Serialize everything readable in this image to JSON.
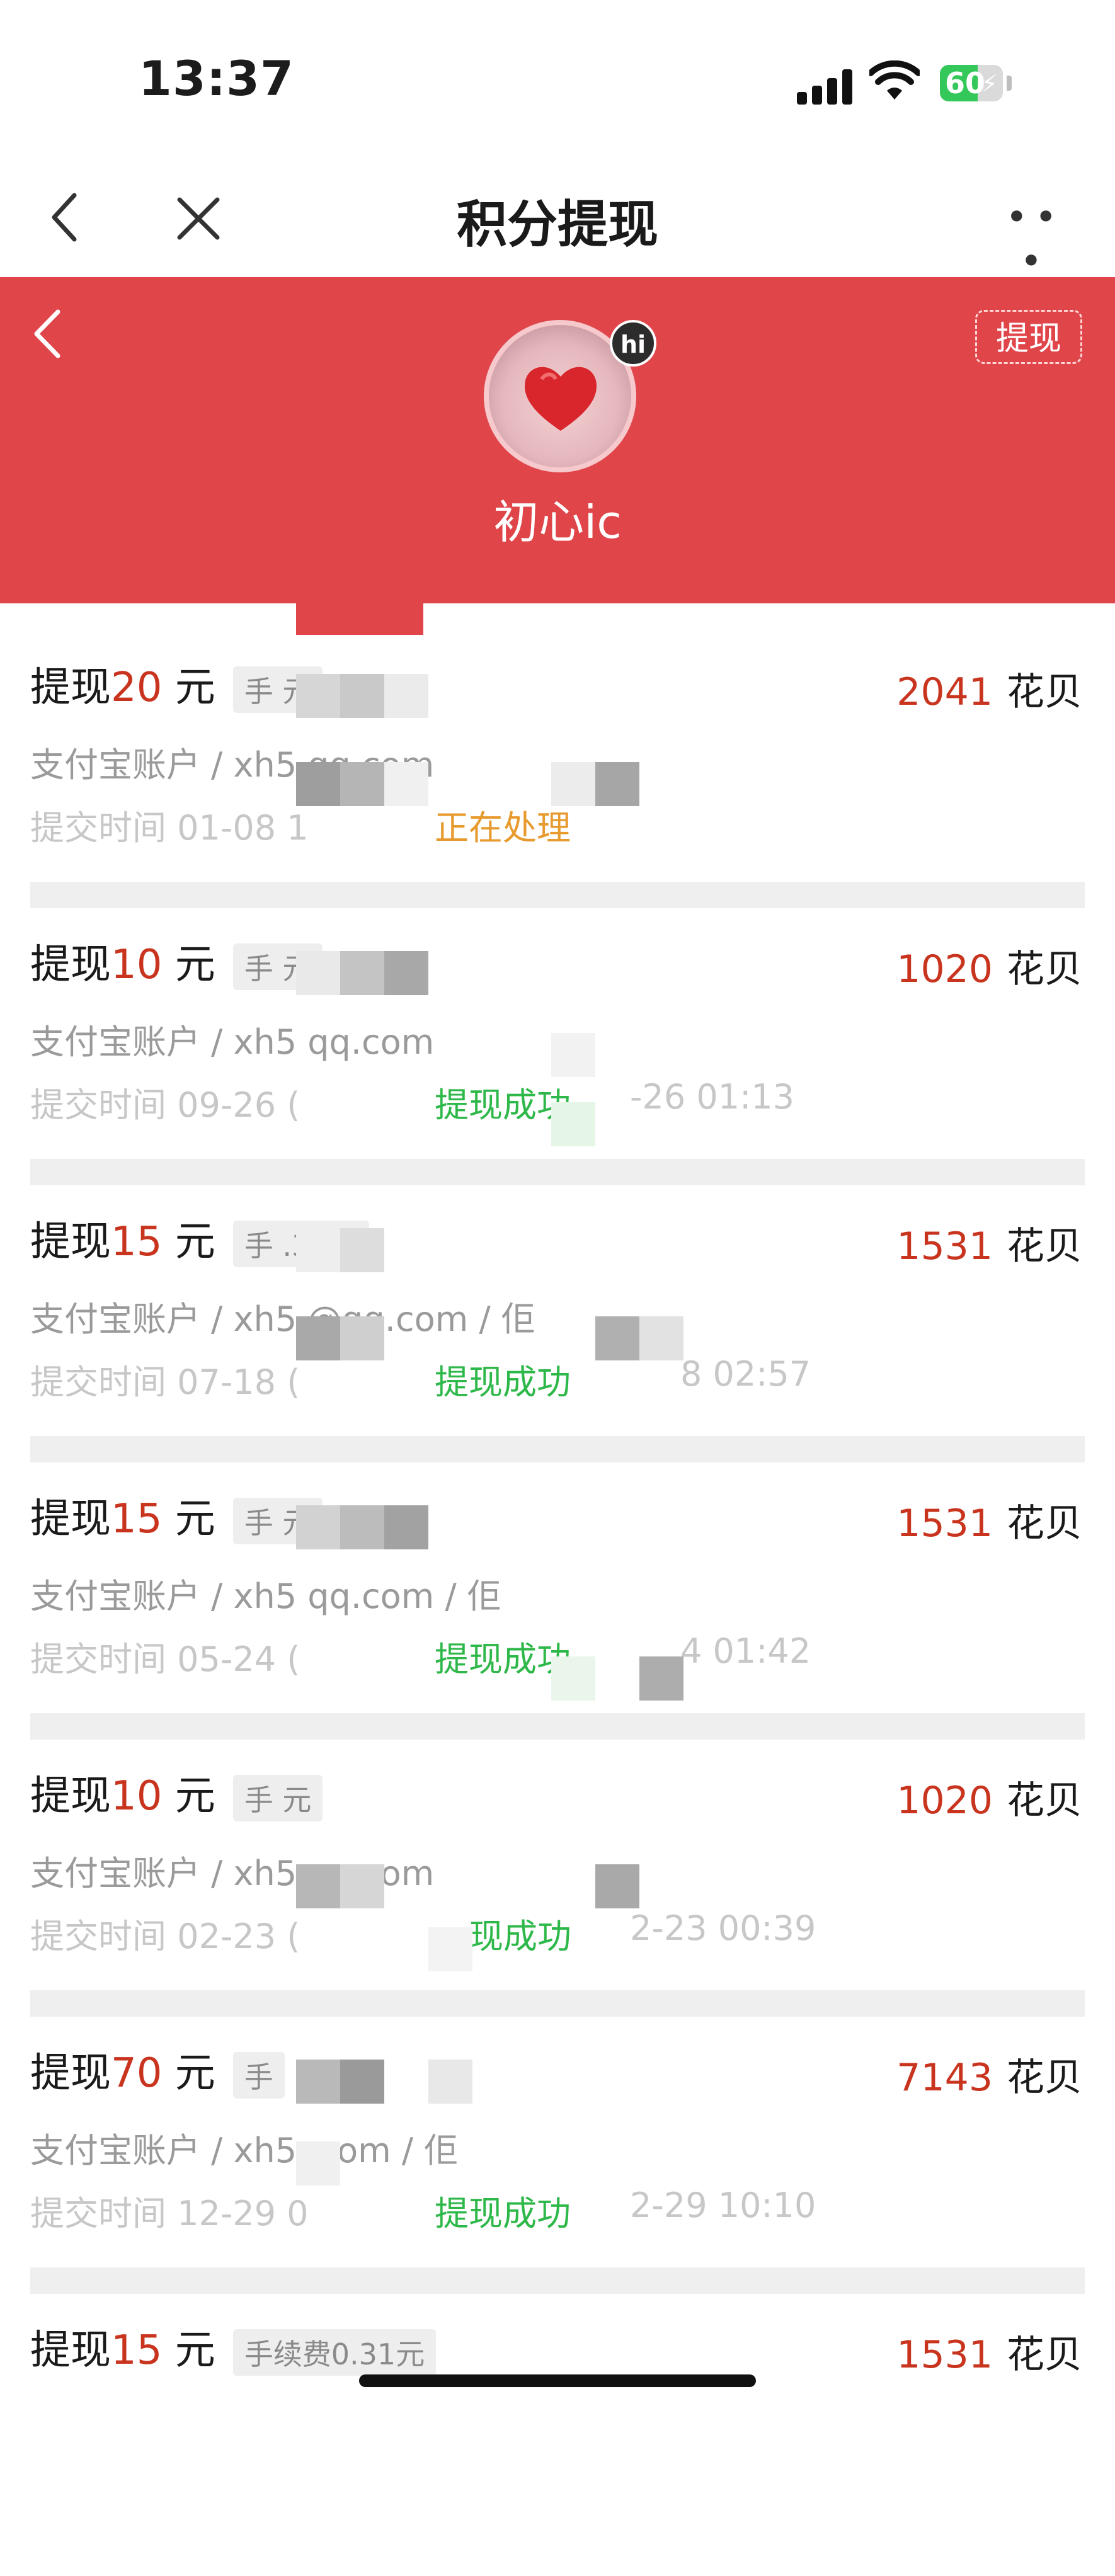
{
  "status_bar": {
    "time": "13:37",
    "battery_percent": "60",
    "battery_level": 0.6
  },
  "nav": {
    "title": "积分提现"
  },
  "header": {
    "withdraw_button": "提现",
    "avatar_badge": "hi",
    "username": "初心ic"
  },
  "records": [
    {
      "title_prefix": "提现",
      "amount": "20",
      "unit": " 元",
      "fee": "手    元",
      "points": "2041",
      "points_unit": "花贝",
      "account": "支付宝账户 / xh5         qq.com",
      "submit_time": "提交时间 01-08 1",
      "status": "正在处理",
      "status_kind": "processing",
      "finish_time": ""
    },
    {
      "title_prefix": "提现",
      "amount": "10",
      "unit": " 元",
      "fee": "手      元",
      "points": "1020",
      "points_unit": "花贝",
      "account": "支付宝账户 / xh5         qq.com",
      "submit_time": "提交时间 09-26 (",
      "status": "提现成功",
      "status_kind": "success",
      "finish_time": "-26 01:13"
    },
    {
      "title_prefix": "提现",
      "amount": "15",
      "unit": " 元",
      "fee": "手   .31元",
      "points": "1531",
      "points_unit": "花贝",
      "account": "支付宝账户 / xh5     @qq.com / 佢",
      "submit_time": "提交时间 07-18 (",
      "status": "提现成功",
      "status_kind": "success",
      "finish_time": "8 02:57"
    },
    {
      "title_prefix": "提现",
      "amount": "15",
      "unit": " 元",
      "fee": "手     元",
      "points": "1531",
      "points_unit": "花贝",
      "account": "支付宝账户 / xh5         qq.com / 佢",
      "submit_time": "提交时间 05-24 (",
      "status": "提现成功",
      "status_kind": "success",
      "finish_time": "4 01:42"
    },
    {
      "title_prefix": "提现",
      "amount": "10",
      "unit": " 元",
      "fee": "手      元",
      "points": "1020",
      "points_unit": "花贝",
      "account": "支付宝账户 / xh5         qq.com",
      "submit_time": "提交时间 02-23 (",
      "status": "现成功",
      "status_kind": "success",
      "finish_time": "2-23 00:39"
    },
    {
      "title_prefix": "提现",
      "amount": "70",
      "unit": " 元",
      "fee": "手      ",
      "points": "7143",
      "points_unit": "花贝",
      "account": "支付宝账户 / xh5          .com / 佢",
      "submit_time": "提交时间 12-29 0",
      "status": "提现成功",
      "status_kind": "success",
      "finish_time": "2-29 10:10"
    },
    {
      "title_prefix": "提现",
      "amount": "15",
      "unit": " 元",
      "fee": "手续费0.31元",
      "points": "1531",
      "points_unit": "花贝",
      "account": "",
      "submit_time": "",
      "status": "",
      "status_kind": "",
      "finish_time": ""
    }
  ],
  "icons": {
    "back": "chevron-left-icon",
    "close": "close-icon",
    "more": "more-dots-icon",
    "header_back": "chevron-left-icon",
    "signal": "signal-icon",
    "wifi": "wifi-icon",
    "battery": "battery-icon"
  },
  "colors": {
    "header_red": "#e0454a",
    "amount_red": "#c9341f",
    "processing_orange": "#e79a2d",
    "success_green": "#2fb84a"
  }
}
